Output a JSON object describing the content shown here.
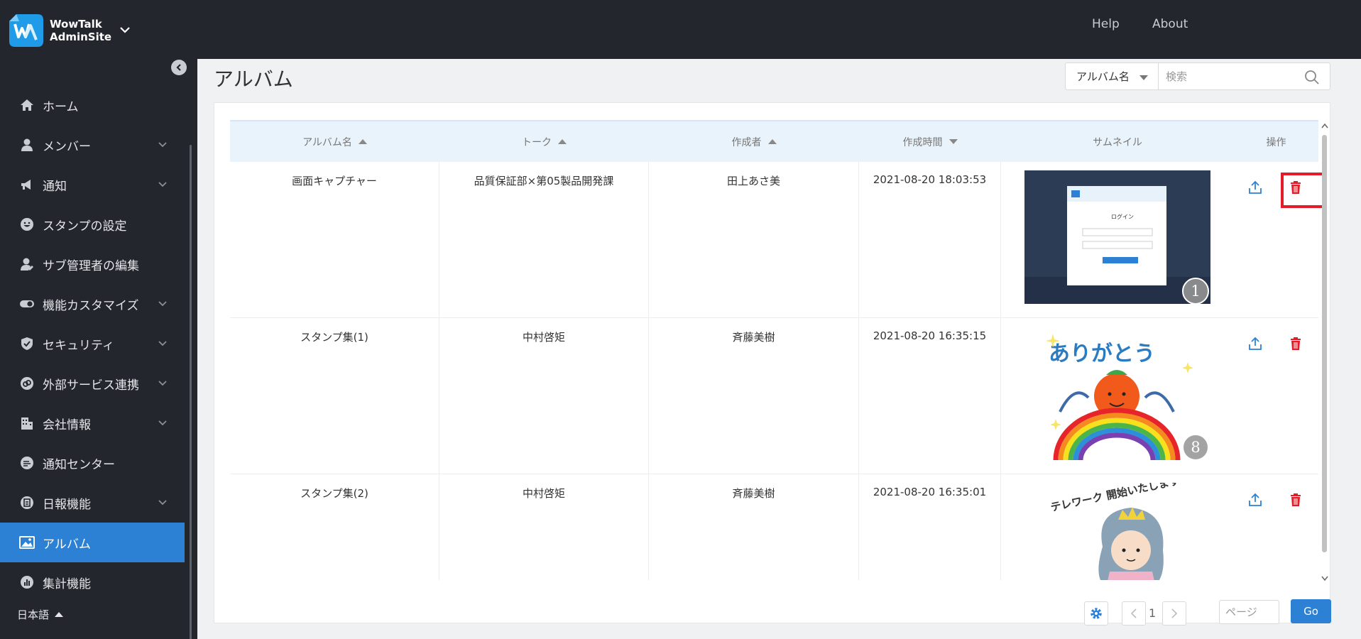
{
  "header": {
    "brand_line1": "WowTalk",
    "brand_line2": "AdminSite",
    "help": "Help",
    "about": "About"
  },
  "sidebar": {
    "items": [
      {
        "label": "ホーム",
        "icon": "home-icon",
        "expandable": false
      },
      {
        "label": "メンバー",
        "icon": "user-icon",
        "expandable": true
      },
      {
        "label": "通知",
        "icon": "megaphone-icon",
        "expandable": true
      },
      {
        "label": "スタンプの設定",
        "icon": "smiley-icon",
        "expandable": false
      },
      {
        "label": "サブ管理者の編集",
        "icon": "user-edit-icon",
        "expandable": false
      },
      {
        "label": "機能カスタマイズ",
        "icon": "toggle-icon",
        "expandable": true
      },
      {
        "label": "セキュリティ",
        "icon": "shield-icon",
        "expandable": true
      },
      {
        "label": "外部サービス連携",
        "icon": "link-icon",
        "expandable": true
      },
      {
        "label": "会社情報",
        "icon": "building-icon",
        "expandable": true
      },
      {
        "label": "通知センター",
        "icon": "notice-center-icon",
        "expandable": false
      },
      {
        "label": "日報機能",
        "icon": "report-icon",
        "expandable": true
      },
      {
        "label": "アルバム",
        "icon": "album-icon",
        "expandable": false,
        "active": true
      },
      {
        "label": "集計機能",
        "icon": "chart-icon",
        "expandable": false
      }
    ],
    "language": "日本語"
  },
  "page": {
    "title": "アルバム"
  },
  "search": {
    "field_selected": "アルバム名",
    "placeholder": "検索"
  },
  "table": {
    "columns": [
      "アルバム名",
      "トーク",
      "作成者",
      "作成時間",
      "サムネイル",
      "操作"
    ],
    "rows": [
      {
        "name": "画面キャプチャー",
        "talk": "品質保証部×第05製品開発課",
        "creator": "田上あさ美",
        "created": "2021-08-20 18:03:53",
        "count": "1"
      },
      {
        "name": "スタンプ集(1)",
        "talk": "中村啓矩",
        "creator": "斉藤美樹",
        "created": "2021-08-20 16:35:15",
        "count": "8"
      },
      {
        "name": "スタンプ集(2)",
        "talk": "中村啓矩",
        "creator": "斉藤美樹",
        "created": "2021-08-20 16:35:01",
        "count": ""
      }
    ],
    "thumb_text": {
      "login_title": "ログイン",
      "thanks": "ありがとう",
      "telework": "テレワーク 開始いたします"
    }
  },
  "pagination": {
    "current": "1",
    "page_placeholder": "ページ",
    "go": "Go"
  },
  "colors": {
    "header_bg": "#23262c",
    "accent": "#2c81d4",
    "delete": "#e21c28"
  }
}
